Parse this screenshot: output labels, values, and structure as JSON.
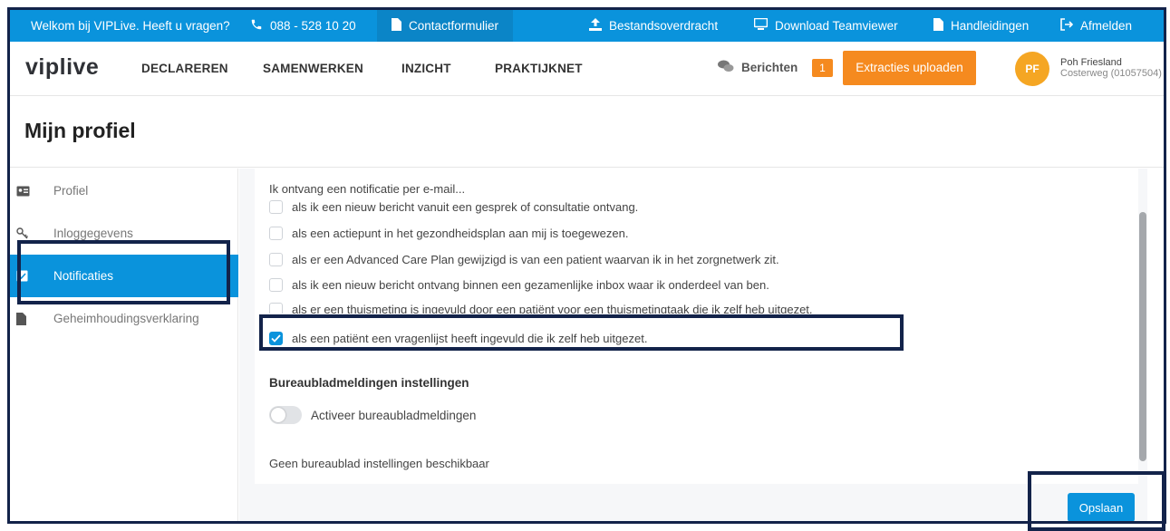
{
  "topbar": {
    "welcome": "Welkom bij VIPLive. Heeft u vragen?",
    "phone": "088 - 528 10 20",
    "contact_form": "Contactformulier",
    "file_transfer": "Bestandsoverdracht",
    "teamviewer": "Download Teamviewer",
    "manuals": "Handleidingen",
    "logout": "Afmelden",
    "icons": [
      "phone-icon",
      "document-icon",
      "upload-icon",
      "monitor-icon",
      "document-icon",
      "logout-icon"
    ]
  },
  "nav": {
    "logo": "viplive",
    "links": [
      "DECLAREREN",
      "SAMENWERKEN",
      "INZICHT",
      "PRAKTIJKNET"
    ],
    "messages_label": "Berichten",
    "messages_count": "1",
    "upload_button": "Extracties uploaden",
    "avatar_initials": "PF",
    "user_name": "Poh Friesland",
    "user_location": "Costerweg (01057504)"
  },
  "page": {
    "title": "Mijn profiel"
  },
  "sidebar": {
    "items": [
      {
        "label": "Profiel",
        "icon": "id-card-icon",
        "active": false
      },
      {
        "label": "Inloggegevens",
        "icon": "key-icon",
        "active": false
      },
      {
        "label": "Notificaties",
        "icon": "check-square-icon",
        "active": true
      },
      {
        "label": "Geheimhoudingsverklaring",
        "icon": "file-icon",
        "active": false
      }
    ]
  },
  "notifications": {
    "intro": "Ik ontvang een notificatie per e-mail...",
    "options": [
      {
        "label": "als ik een nieuw bericht vanuit een gesprek of consultatie ontvang.",
        "checked": false
      },
      {
        "label": "als een actiepunt in het gezondheidsplan aan mij is toegewezen.",
        "checked": false
      },
      {
        "label": "als er een Advanced Care Plan gewijzigd is van een patient waarvan ik in het zorgnetwerk zit.",
        "checked": false
      },
      {
        "label": "als ik een nieuw bericht ontvang binnen een gezamenlijke inbox waar ik onderdeel van ben.",
        "checked": false
      },
      {
        "label": "als er een thuismeting is ingevuld door een patiënt voor een thuismetingtaak die ik zelf heb uitgezet.",
        "checked": false
      },
      {
        "label": "als een patiënt een vragenlijst heeft ingevuld die ik zelf heb uitgezet.",
        "checked": true
      }
    ],
    "desktop_title": "Bureaubladmeldingen instellingen",
    "desktop_toggle_label": "Activeer bureaubladmeldingen",
    "desktop_toggle_on": false,
    "desktop_none": "Geen bureaublad instellingen beschikbaar",
    "save_button": "Opslaan"
  },
  "colors": {
    "primary": "#0a93dc",
    "accent": "#f58a1f",
    "highlight": "#13234a"
  }
}
